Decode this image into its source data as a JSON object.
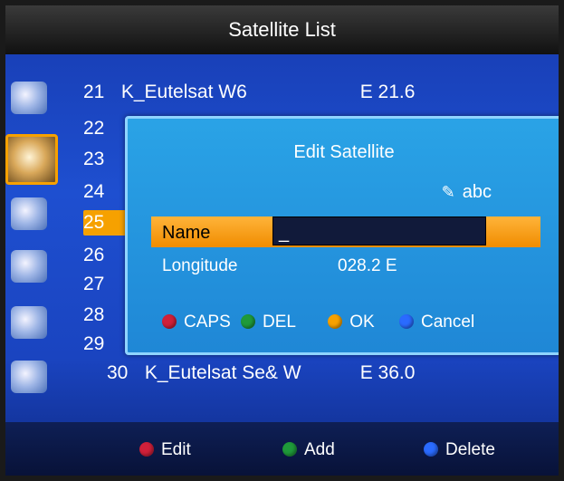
{
  "window": {
    "title": "Satellite List"
  },
  "sidebar": {
    "icons": [
      "monitor-icon",
      "satellite-dish-icon",
      "gears-icon",
      "toolbox-icon",
      "film-reel-icon",
      "globe-icon"
    ]
  },
  "satellite_list": {
    "rows": [
      {
        "num": "21",
        "name": "K_Eutelsat W6",
        "pos": "E 21.6"
      },
      {
        "num": "22",
        "name": "",
        "pos": ""
      },
      {
        "num": "23",
        "name": "",
        "pos": ""
      },
      {
        "num": "24",
        "name": "",
        "pos": ""
      },
      {
        "num": "25",
        "name": "",
        "pos": ""
      },
      {
        "num": "26",
        "name": "",
        "pos": ""
      },
      {
        "num": "27",
        "name": "",
        "pos": ""
      },
      {
        "num": "28",
        "name": "",
        "pos": ""
      },
      {
        "num": "29",
        "name": "",
        "pos": ""
      },
      {
        "num": "30",
        "name": "K_Eutelsat Se& W",
        "pos": "E 36.0"
      }
    ]
  },
  "dialog": {
    "title": "Edit Satellite",
    "input_mode": "abc",
    "name_label": "Name",
    "name_value": "_",
    "longitude_label": "Longitude",
    "longitude_value": "028.2 E",
    "keys": [
      {
        "color": "#d0203a",
        "label": "CAPS"
      },
      {
        "color": "#1f9a3a",
        "label": "DEL"
      },
      {
        "color": "#f6a100",
        "label": "OK"
      },
      {
        "color": "#2a6bff",
        "label": "Cancel"
      }
    ]
  },
  "footer": {
    "edit": {
      "color": "#d0203a",
      "label": "Edit"
    },
    "add": {
      "color": "#1f9a3a",
      "label": "Add"
    },
    "delete": {
      "color": "#2a6bff",
      "label": "Delete"
    }
  },
  "colors": {
    "accent": "#f6a100",
    "dialog_bg": "#1f87d6",
    "screen_bg": "#1e4fd0"
  }
}
